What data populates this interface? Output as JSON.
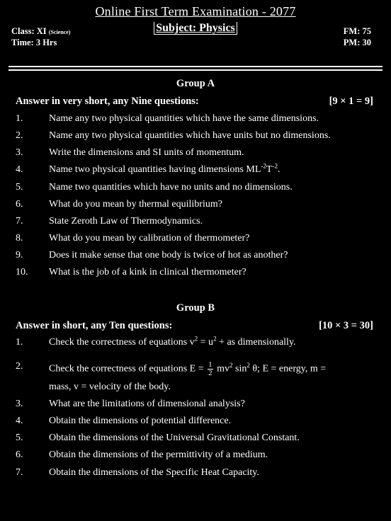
{
  "header": {
    "title": "Online First Term Examination - 2077",
    "class_label": "Class: XI",
    "class_stream": "(Science)",
    "time_label": "Time: 3 Hrs",
    "subject_label": "Subject: Physics",
    "fm_label": "FM: 75",
    "pm_label": "PM: 30"
  },
  "group_a": {
    "heading": "Group A",
    "instruction": "Answer in very short, any Nine questions:",
    "marks": "[9 × 1 = 9]",
    "questions": [
      {
        "num": "1.",
        "text": "Name any two physical quantities which have the same dimensions."
      },
      {
        "num": "2.",
        "text": "Name any two physical quantities which have units but no dimensions."
      },
      {
        "num": "3.",
        "text": "Write the dimensions and SI units of momentum."
      },
      {
        "num": "4.",
        "text_before": "Name two physical quantities having dimensions ML",
        "sup1": "-2",
        "mid": "T",
        "sup2": "-2",
        "text_after": "."
      },
      {
        "num": "5.",
        "text": "Name two quantities which have no units and no dimensions."
      },
      {
        "num": "6.",
        "text": "What do you mean by thermal equilibrium?"
      },
      {
        "num": "7.",
        "text": "State Zeroth Law of Thermodynamics."
      },
      {
        "num": "8.",
        "text": "What do you mean by calibration of thermometer?"
      },
      {
        "num": "9.",
        "text": "Does it make sense that one body is twice of hot as another?"
      },
      {
        "num": "10.",
        "text": "What is the job of a kink in clinical thermometer?"
      }
    ]
  },
  "group_b": {
    "heading": "Group B",
    "instruction": "Answer in short, any Ten questions:",
    "marks": "[10 × 3 = 30]",
    "q1": {
      "num": "1.",
      "a": "Check the correctness of equations v",
      "s1": "2",
      "b": " = u",
      "s2": "2",
      "c": " + as dimensionally."
    },
    "q2": {
      "num": "2.",
      "a": "Check the correctness of equations E = ",
      "frac_n": "1",
      "frac_d": "2",
      "b": " mv",
      "s1": "2",
      "c": " sin",
      "s2": "2",
      "d": " θ; E = energy, m =",
      "cont": "mass, v = velocity of the body."
    },
    "questions": [
      {
        "num": "3.",
        "text": "What are the limitations of dimensional analysis?"
      },
      {
        "num": "4.",
        "text": "Obtain the dimensions of potential difference."
      },
      {
        "num": "5.",
        "text": "Obtain the dimensions of the Universal Gravitational Constant."
      },
      {
        "num": "6.",
        "text": "Obtain the dimensions of the permittivity of a medium."
      },
      {
        "num": "7.",
        "text": "Obtain the dimensions of the Specific Heat Capacity."
      }
    ]
  }
}
